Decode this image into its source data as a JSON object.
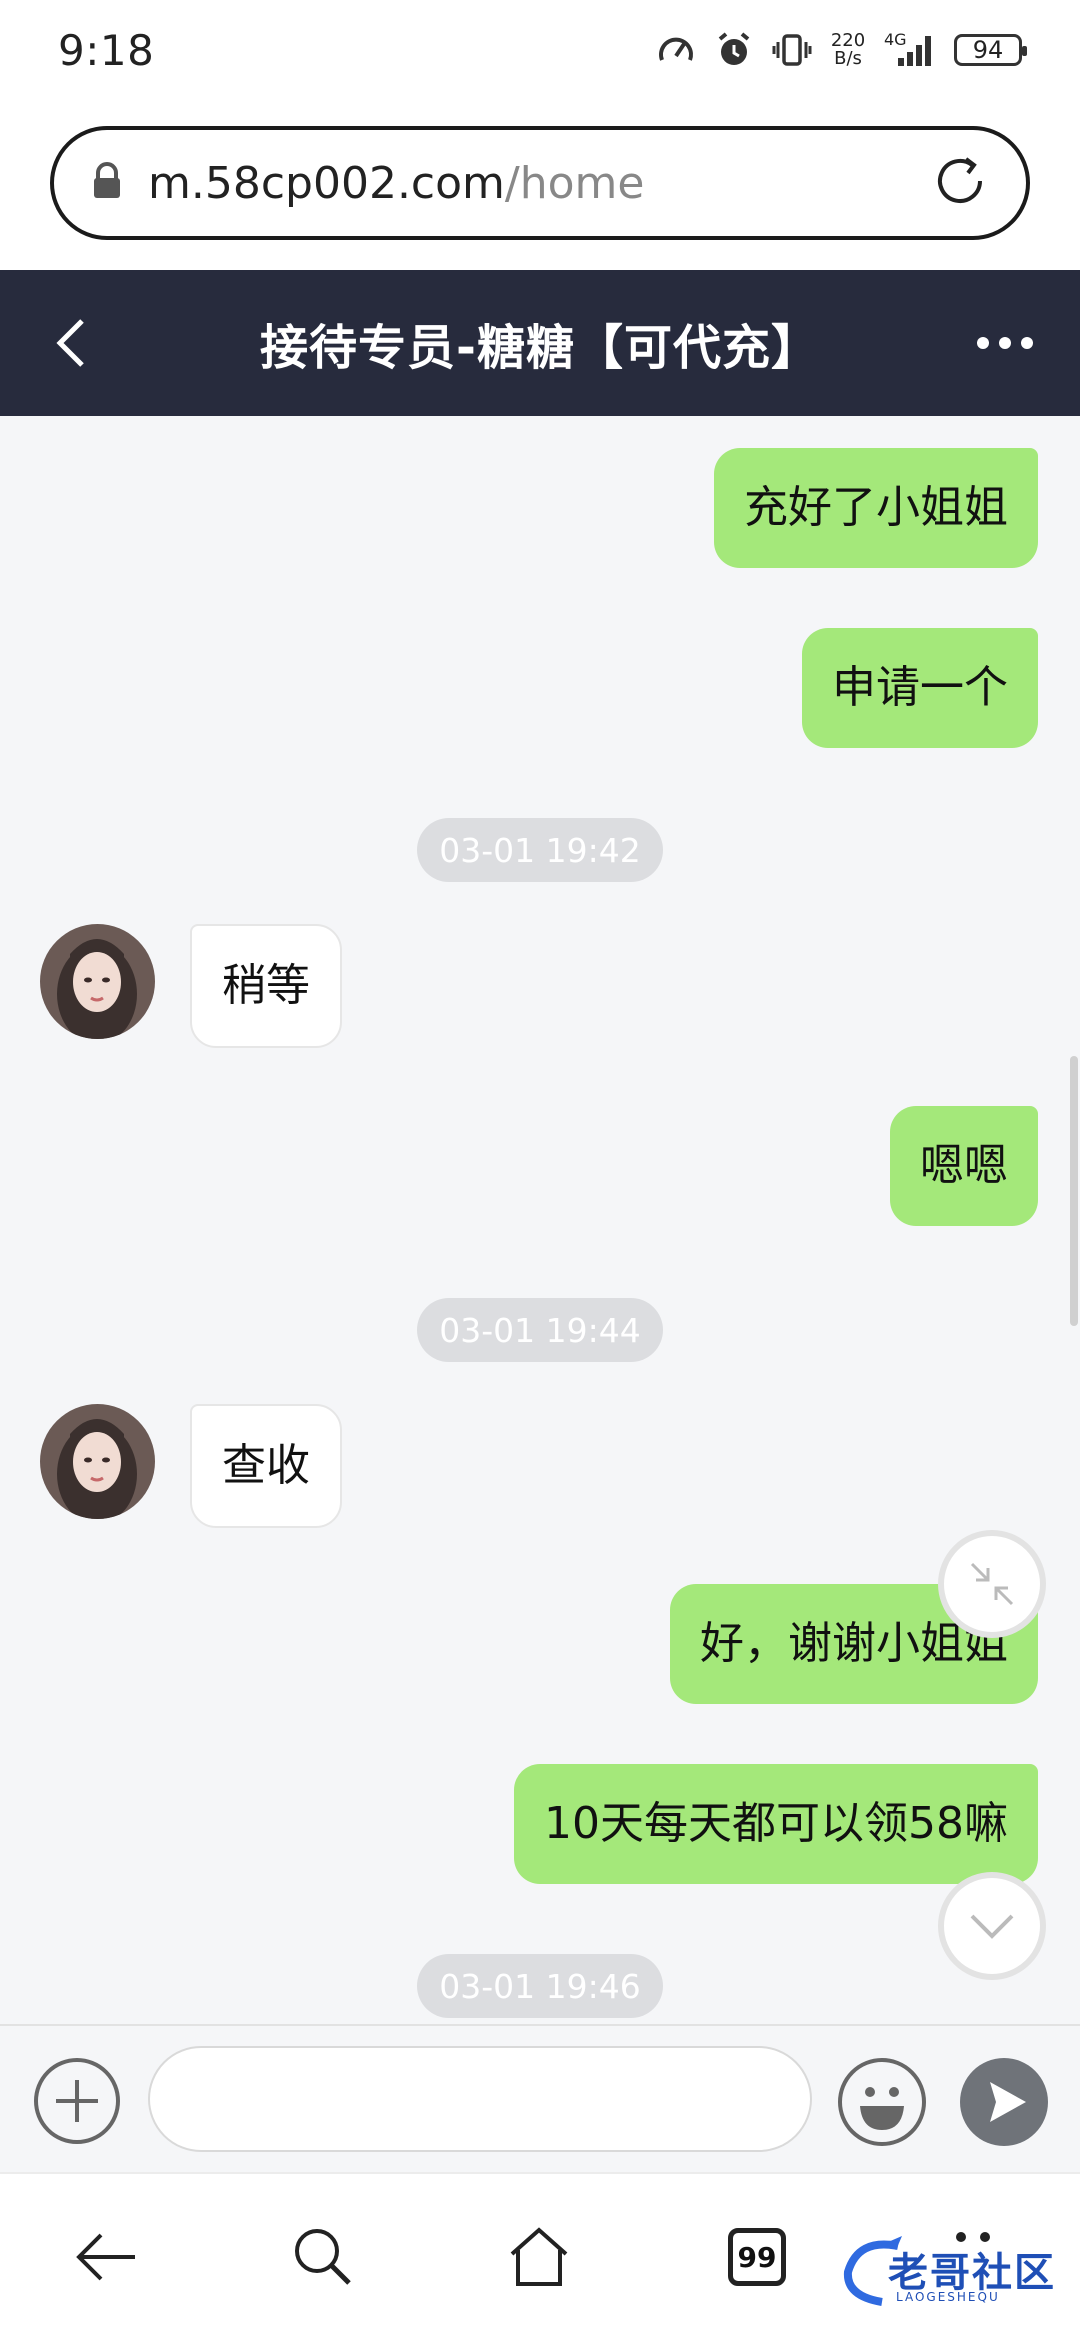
{
  "status_bar": {
    "time": "9:18",
    "net_speed_value": "220",
    "net_speed_unit": "B/s",
    "network": "4G",
    "battery": "94"
  },
  "browser": {
    "url_host": "m.58cp002.com",
    "url_path": "/home"
  },
  "header": {
    "title": "接待专员-糖糖【可代充】"
  },
  "messages": [
    {
      "type": "out",
      "text": "充好了小姐姐"
    },
    {
      "type": "out",
      "text": "申请一个"
    },
    {
      "type": "time",
      "text": "03-01 19:42"
    },
    {
      "type": "in",
      "text": "稍等"
    },
    {
      "type": "out",
      "text": "嗯嗯"
    },
    {
      "type": "time",
      "text": "03-01 19:44"
    },
    {
      "type": "in",
      "text": "查收"
    },
    {
      "type": "out",
      "text": "好，谢谢小姐姐"
    },
    {
      "type": "out",
      "text": "10天每天都可以领58嘛"
    },
    {
      "type": "time",
      "text": "03-01 19:46"
    }
  ],
  "input": {
    "value": ""
  },
  "nav": {
    "tabs_count": "99"
  },
  "watermark": {
    "text": "老哥社区",
    "sub": "LAOGESHEQU"
  },
  "colors": {
    "header_bg": "#272b3d",
    "outgoing_bubble": "#a4e87a",
    "incoming_bubble": "#ffffff",
    "timestamp_bg": "#dcdde0"
  }
}
